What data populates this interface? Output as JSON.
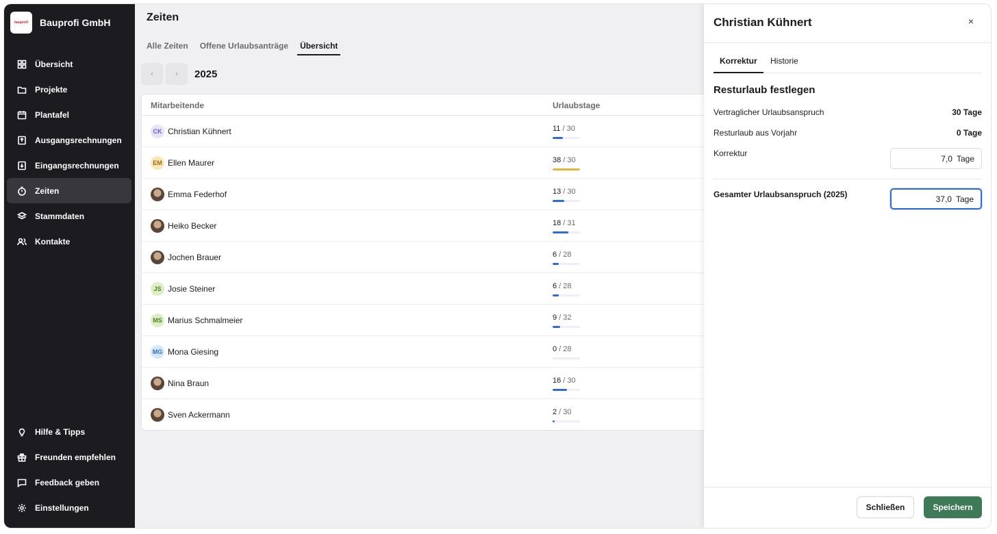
{
  "brand": {
    "name": "Bauprofi GmbH",
    "logo_text": "bauprofi"
  },
  "sidebar": {
    "items": [
      {
        "label": "Übersicht",
        "icon": "grid-icon"
      },
      {
        "label": "Projekte",
        "icon": "folder-icon"
      },
      {
        "label": "Plantafel",
        "icon": "calendar-icon"
      },
      {
        "label": "Ausgangsrechnungen",
        "icon": "invoice-out-icon"
      },
      {
        "label": "Eingangsrechnungen",
        "icon": "invoice-in-icon"
      },
      {
        "label": "Zeiten",
        "icon": "stopwatch-icon",
        "active": true
      },
      {
        "label": "Stammdaten",
        "icon": "layers-icon"
      },
      {
        "label": "Kontakte",
        "icon": "users-icon"
      }
    ],
    "bottom_items": [
      {
        "label": "Hilfe & Tipps",
        "icon": "lightbulb-icon"
      },
      {
        "label": "Freunden empfehlen",
        "icon": "gift-icon"
      },
      {
        "label": "Feedback geben",
        "icon": "message-icon"
      },
      {
        "label": "Einstellungen",
        "icon": "settings-icon"
      }
    ]
  },
  "main": {
    "title": "Zeiten",
    "tabs": [
      "Alle Zeiten",
      "Offene Urlaubsanträge",
      "Übersicht"
    ],
    "active_tab": 2,
    "year": "2025",
    "prev_icon": "‹",
    "next_icon": "›",
    "table": {
      "headers": {
        "name": "Mitarbeitende",
        "days": "Urlaubstage"
      },
      "rows": [
        {
          "initials": "CK",
          "name": "Christian Kühnert",
          "used": "11",
          "total": "30",
          "ratio": 0.367,
          "avatar_bg": "#e6e3fb",
          "avatar_fg": "#6a5acd",
          "bar_color": "#2f6bd6"
        },
        {
          "initials": "EM",
          "name": "Ellen Maurer",
          "used": "38",
          "total": "30",
          "ratio": 1.0,
          "avatar_bg": "#fbe7b8",
          "avatar_fg": "#9a6b12",
          "bar_color": "#e0b63a"
        },
        {
          "initials": "",
          "name": "Emma Federhof",
          "used": "13",
          "total": "30",
          "ratio": 0.433,
          "photo": true,
          "bar_color": "#2f6bd6"
        },
        {
          "initials": "",
          "name": "Heiko Becker",
          "used": "18",
          "total": "31",
          "ratio": 0.58,
          "photo": true,
          "bar_color": "#2f6bd6"
        },
        {
          "initials": "",
          "name": "Jochen Brauer",
          "used": "6",
          "total": "28",
          "ratio": 0.214,
          "photo": true,
          "bar_color": "#2f6bd6"
        },
        {
          "initials": "JS",
          "name": "Josie Steiner",
          "used": "6",
          "total": "28",
          "ratio": 0.214,
          "avatar_bg": "#dcefc4",
          "avatar_fg": "#557a2a",
          "bar_color": "#2f6bd6"
        },
        {
          "initials": "MS",
          "name": "Marius Schmalmeier",
          "used": "9",
          "total": "32",
          "ratio": 0.281,
          "avatar_bg": "#dcefc4",
          "avatar_fg": "#557a2a",
          "bar_color": "#2f6bd6"
        },
        {
          "initials": "MG",
          "name": "Mona Giesing",
          "used": "0",
          "total": "28",
          "ratio": 0.0,
          "avatar_bg": "#d6e7fb",
          "avatar_fg": "#2d6fb7",
          "bar_color": "#2f6bd6"
        },
        {
          "initials": "",
          "name": "Nina Braun",
          "used": "16",
          "total": "30",
          "ratio": 0.533,
          "photo": true,
          "bar_color": "#2f6bd6"
        },
        {
          "initials": "",
          "name": "Sven Ackermann",
          "used": "2",
          "total": "30",
          "ratio": 0.067,
          "photo": true,
          "bar_color": "#2f6bd6"
        }
      ]
    }
  },
  "drawer": {
    "title": "Christian Kühnert",
    "close_icon": "×",
    "tabs": [
      "Korrektur",
      "Historie"
    ],
    "section_title": "Resturlaub festlegen",
    "contract_label": "Vertraglicher Urlaubsanspruch",
    "contract_value": "30 Tage",
    "carryover_label": "Resturlaub aus Vorjahr",
    "carryover_value": "0 Tage",
    "correction_label": "Korrektur",
    "correction_value": "7,0",
    "unit": "Tage",
    "total_label": "Gesamter Urlaubsanspruch (2025)",
    "total_value": "37,0",
    "close_button": "Schließen",
    "save_button": "Speichern"
  },
  "colors": {
    "accent": "#2f6bd6",
    "primary_button": "#3e7a57",
    "sidebar_bg": "#1c1b1f"
  }
}
